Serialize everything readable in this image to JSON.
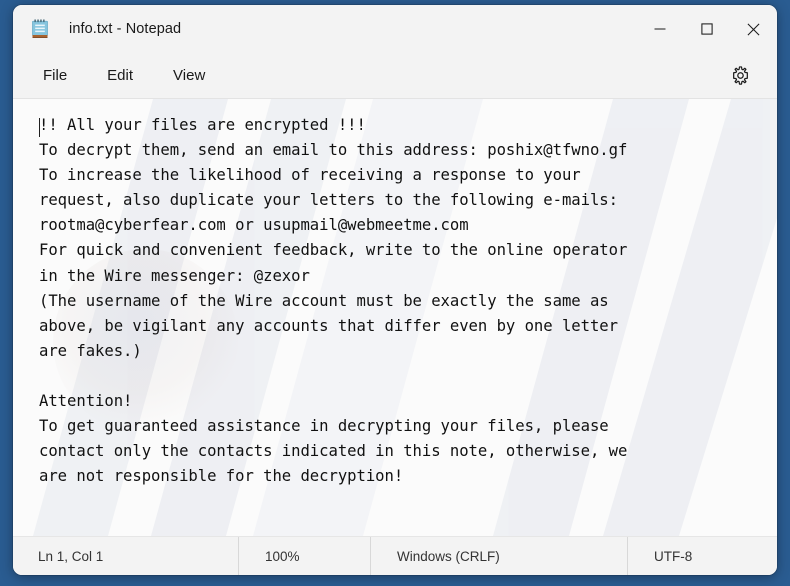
{
  "window": {
    "icon": "notepad-icon",
    "title": "info.txt - Notepad",
    "accent_color": "#2a5c91",
    "chrome_color": "#f3f3f3",
    "editor_color": "#fbfbfb",
    "controls": {
      "minimize_label": "Minimize",
      "maximize_label": "Maximize",
      "close_label": "Close"
    }
  },
  "menu": {
    "items": [
      {
        "label": "File"
      },
      {
        "label": "Edit"
      },
      {
        "label": "View"
      }
    ],
    "settings_label": "Settings"
  },
  "editor": {
    "content": "!! All your files are encrypted !!!\nTo decrypt them, send an email to this address: poshix@tfwno.gf\nTo increase the likelihood of receiving a response to your\nrequest, also duplicate your letters to the following e-mails:\nrootma@cyberfear.com or usupmail@webmeetme.com\nFor quick and convenient feedback, write to the online operator\nin the Wire messenger: @zexor\n(The username of the Wire account must be exactly the same as\nabove, be vigilant any accounts that differ even by one letter\nare fakes.)\n\nAttention!\nTo get guaranteed assistance in decrypting your files, please\ncontact only the contacts indicated in this note, otherwise, we\nare not responsible for the decryption!",
    "placeholder": "",
    "contacts": {
      "primary_email": "poshix@tfwno.gf",
      "backup_email_1": "rootma@cyberfear.com",
      "backup_email_2": "usupmail@webmeetme.com",
      "wire_messenger": "@zexor"
    }
  },
  "status": {
    "ln_col": "Ln 1, Col 1",
    "zoom": "100%",
    "line_ending": "Windows (CRLF)",
    "encoding": "UTF-8"
  }
}
